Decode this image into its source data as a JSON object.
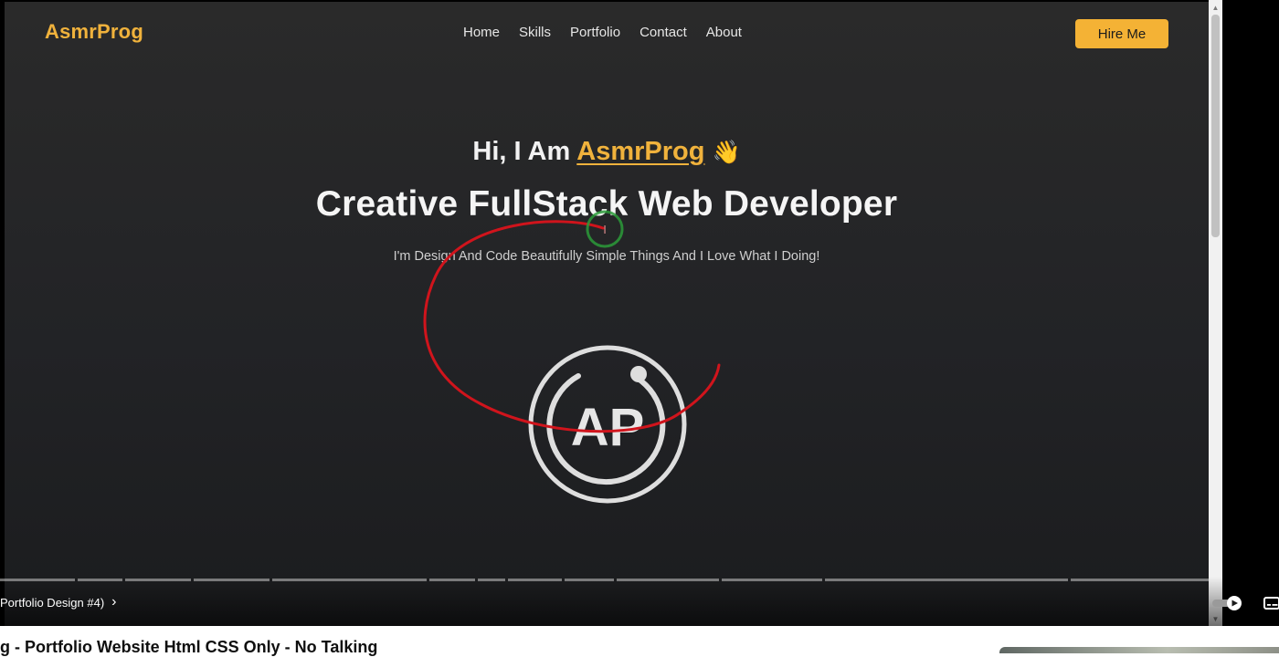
{
  "site": {
    "logo": "AsmrProg",
    "nav": [
      "Home",
      "Skills",
      "Portfolio",
      "Contact",
      "About"
    ],
    "hire_label": "Hire Me",
    "greeting_prefix": "Hi, I Am ",
    "greeting_name": "AsmrProg",
    "greeting_emoji": "👋",
    "headline": "Creative FullStack Web Developer",
    "tagline": "I'm Design And Code Beautifully Simple Things And I Love What I Doing!",
    "logo_mark_text": "AP"
  },
  "player": {
    "chapter_title": "Portfolio Design #4)",
    "controls": [
      "autoplay-toggle-icon",
      "closed-captions-icon"
    ],
    "video_title": "g - Portfolio Website Html CSS Only - No Talking"
  },
  "colors": {
    "accent": "#f4b235",
    "background": "#222326",
    "annotation": "#d0141c"
  }
}
